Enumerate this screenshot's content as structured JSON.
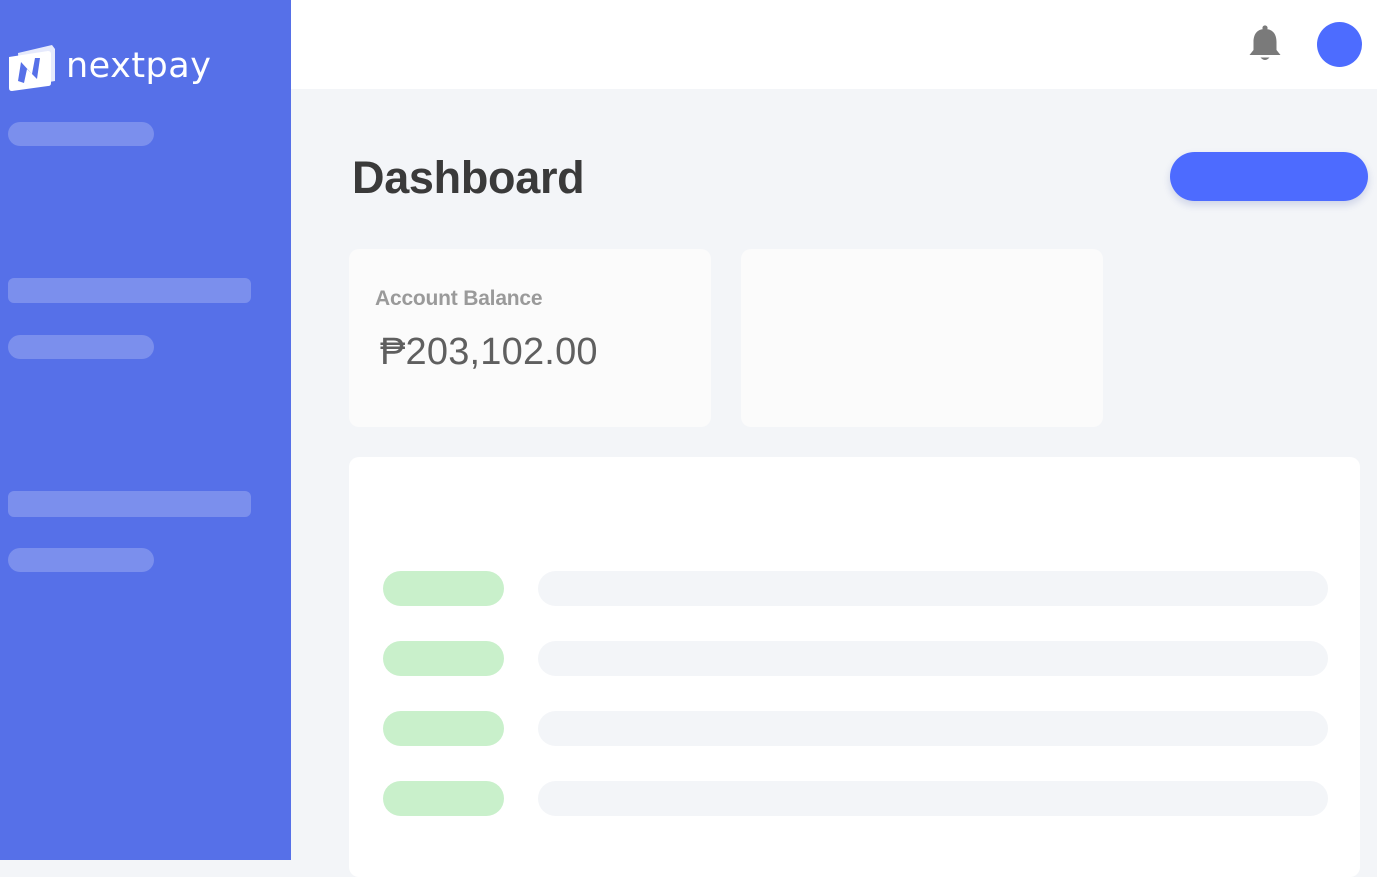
{
  "app": {
    "brand_name": "nextpay",
    "accent_color": "#5670e8",
    "button_color": "#4d6bff"
  },
  "sidebar": {
    "logo_icon": "nextpay-wallet-logo-icon",
    "nav_placeholders": [
      {
        "id": "nav-placeholder-1"
      },
      {
        "id": "nav-placeholder-2"
      },
      {
        "id": "nav-placeholder-3"
      },
      {
        "id": "nav-placeholder-4"
      },
      {
        "id": "nav-placeholder-5"
      }
    ]
  },
  "header": {
    "notification_icon": "bell-icon",
    "avatar_color": "#4d6cff"
  },
  "main": {
    "title": "Dashboard",
    "balance_card": {
      "label": "Account Balance",
      "value": "₱203,102.00"
    },
    "transactions": {
      "status_color": "#c9f0cb",
      "row_count": 4
    }
  }
}
